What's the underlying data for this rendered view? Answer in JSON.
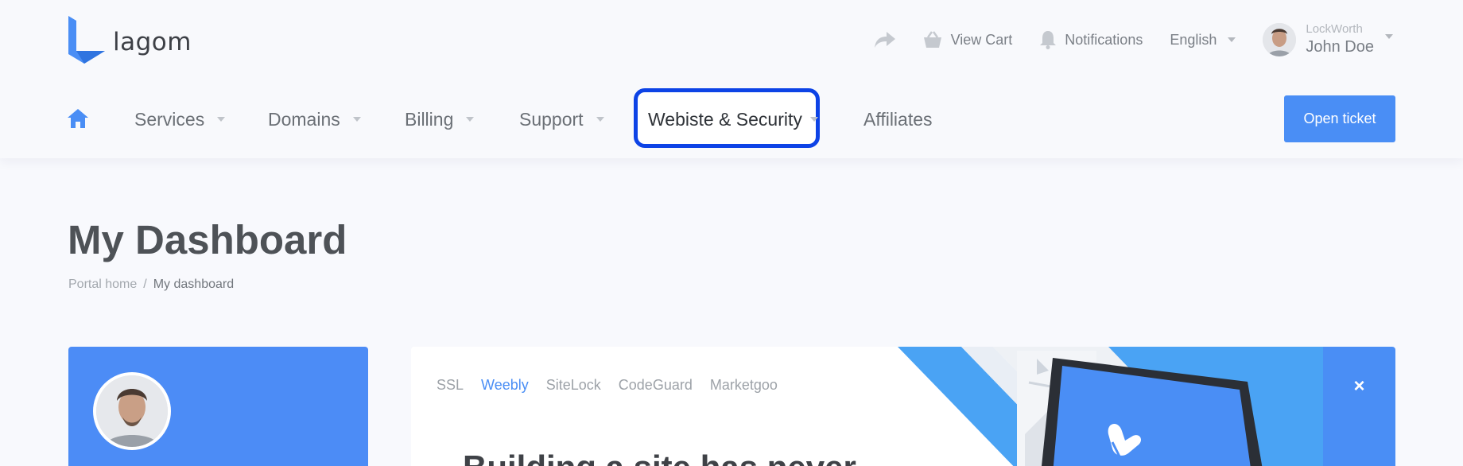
{
  "brand": {
    "name": "lagom"
  },
  "utility_bar": {
    "view_cart_label": "View Cart",
    "notifications_label": "Notifications",
    "language_label": "English",
    "user_company": "LockWorth",
    "user_name": "John Doe"
  },
  "nav": {
    "items": [
      {
        "label": "Services",
        "has_dropdown": true
      },
      {
        "label": "Domains",
        "has_dropdown": true
      },
      {
        "label": "Billing",
        "has_dropdown": true
      },
      {
        "label": "Support",
        "has_dropdown": true
      },
      {
        "label": "Webiste & Security",
        "has_dropdown": true,
        "highlighted": true
      },
      {
        "label": "Affiliates",
        "has_dropdown": false
      }
    ],
    "open_ticket_label": "Open ticket"
  },
  "page": {
    "title": "My Dashboard",
    "breadcrumb": {
      "home": "Portal home",
      "separator": "/",
      "current": "My dashboard"
    }
  },
  "promo": {
    "tabs": [
      {
        "label": "SSL",
        "active": false
      },
      {
        "label": "Weebly",
        "active": true
      },
      {
        "label": "SiteLock",
        "active": false
      },
      {
        "label": "CodeGuard",
        "active": false
      },
      {
        "label": "Marketgoo",
        "active": false
      }
    ],
    "heading": "Building a site has never",
    "close_symbol": "×"
  },
  "colors": {
    "accent": "#4a8ef5",
    "highlight_border": "#0d43e6",
    "header_bg": "#f8f9fc",
    "page_bg": "#f8f9fd"
  }
}
